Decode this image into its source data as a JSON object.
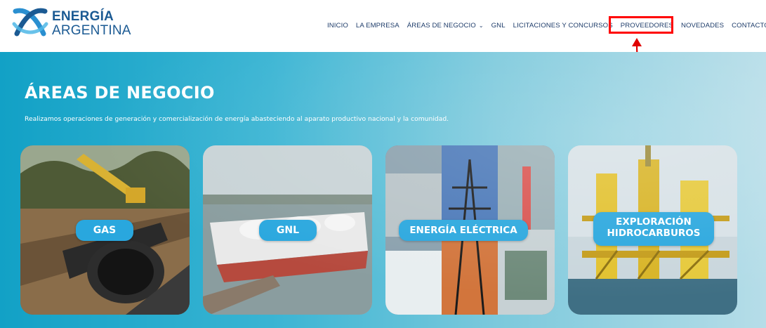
{
  "brand": {
    "line1": "ENERGÍA",
    "line2": "ARGENTINA",
    "logo_icon": "energia-argentina-logo"
  },
  "nav": {
    "items": [
      {
        "label": "INICIO"
      },
      {
        "label": "LA EMPRESA"
      },
      {
        "label": "ÁREAS DE NEGOCIO",
        "chevron": "⌄"
      },
      {
        "label": "GNL"
      },
      {
        "label": "LICITACIONES Y CONCURSOS"
      },
      {
        "label": "PROVEEDORES"
      },
      {
        "label": "NOVEDADES"
      },
      {
        "label": "CONTACTO"
      }
    ]
  },
  "annotation": {
    "label": "a",
    "color": "#ff0000"
  },
  "hero": {
    "title": "ÁREAS DE NEGOCIO",
    "subtitle": "Realizamos operaciones de generación y comercialización de energía abasteciendo al aparato productivo nacional y la comunidad."
  },
  "cards": [
    {
      "label": "GAS"
    },
    {
      "label": "GNL"
    },
    {
      "label": "ENERGÍA ELÉCTRICA"
    },
    {
      "label_line1": "EXPLORACIÓN",
      "label_line2": "HIDROCARBUROS"
    }
  ],
  "colors": {
    "brand_blue": "#1b5a93",
    "nav_text": "#1e3c6a",
    "pill_blue": "#29a7de",
    "hero_start": "#12a1c6",
    "hero_end": "#b6dde8"
  }
}
